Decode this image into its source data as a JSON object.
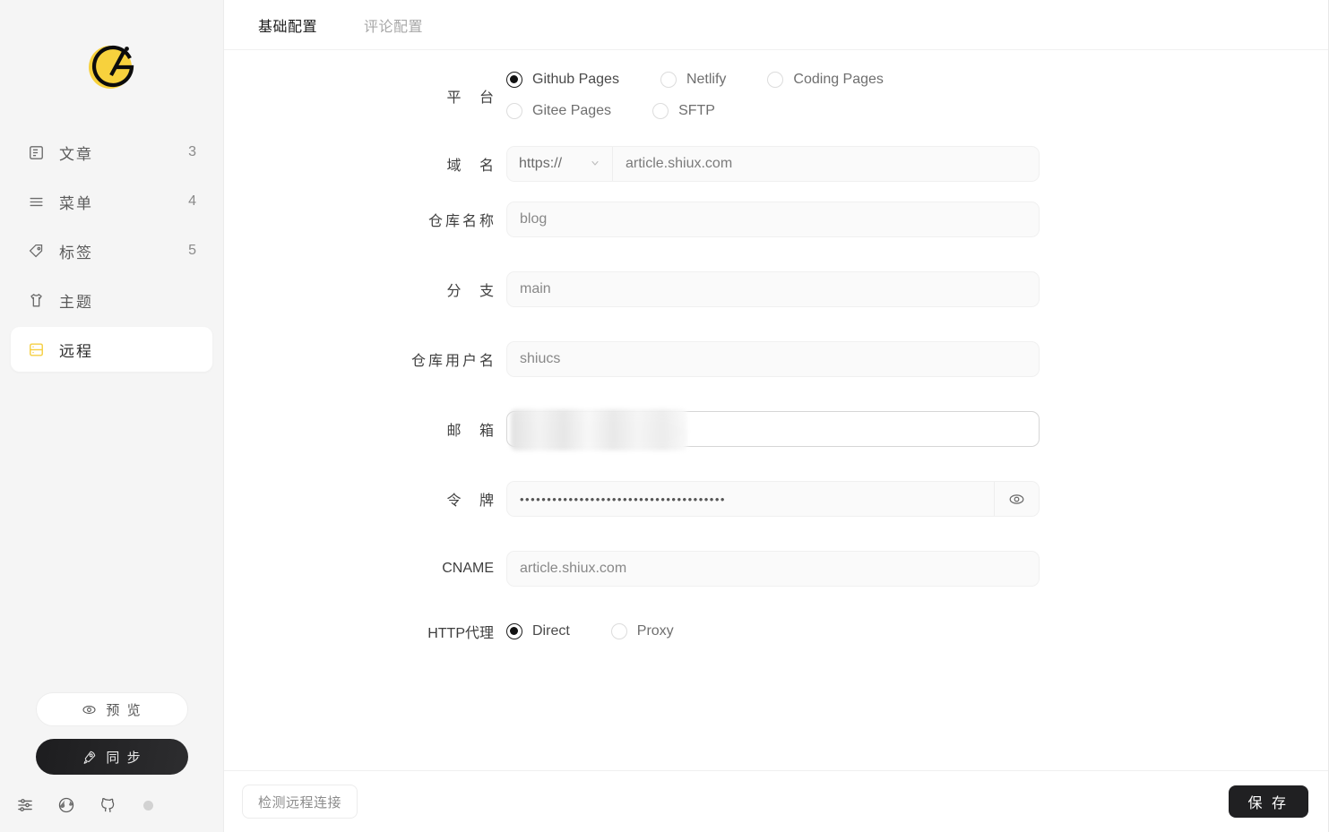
{
  "sidebar": {
    "logo_name": "gridea-logo",
    "items": [
      {
        "label": "文章",
        "count": "3",
        "icon": "article-icon",
        "active": false
      },
      {
        "label": "菜单",
        "count": "4",
        "icon": "menu-icon",
        "active": false
      },
      {
        "label": "标签",
        "count": "5",
        "icon": "tag-icon",
        "active": false
      },
      {
        "label": "主题",
        "count": "",
        "icon": "theme-icon",
        "active": false
      },
      {
        "label": "远程",
        "count": "",
        "icon": "server-icon",
        "active": true
      }
    ],
    "preview_button": "预 览",
    "sync_button": "同 步",
    "bottom_icons": [
      "settings-sliders-icon",
      "globe-icon",
      "github-icon",
      "status-dot-icon"
    ]
  },
  "tabs": [
    {
      "label": "基础配置",
      "active": true
    },
    {
      "label": "评论配置",
      "active": false
    }
  ],
  "form": {
    "platform": {
      "label": "平 台",
      "options": [
        {
          "label": "Github Pages",
          "selected": true
        },
        {
          "label": "Netlify",
          "selected": false
        },
        {
          "label": "Coding Pages",
          "selected": false
        },
        {
          "label": "Gitee Pages",
          "selected": false
        },
        {
          "label": "SFTP",
          "selected": false
        }
      ]
    },
    "domain": {
      "label": "域 名",
      "protocol": "https://",
      "value": "article.shiux.com"
    },
    "repository": {
      "label": "仓库名称",
      "value": "blog"
    },
    "branch": {
      "label": "分 支",
      "value": "main"
    },
    "username": {
      "label": "仓库用户名",
      "value": "shiucs"
    },
    "email": {
      "label": "邮 箱",
      "value": ""
    },
    "token": {
      "label": "令 牌",
      "value": "••••••••••••••••••••••••••••••••••••••",
      "toggle_icon": "eye-icon"
    },
    "cname": {
      "label": "CNAME",
      "value": "article.shiux.com"
    },
    "proxy": {
      "label": "HTTP代理",
      "options": [
        {
          "label": "Direct",
          "selected": true
        },
        {
          "label": "Proxy",
          "selected": false
        }
      ]
    }
  },
  "footer": {
    "test_button": "检测远程连接",
    "save_button": "保 存"
  },
  "colors": {
    "accent": "#f5cf43",
    "dark": "#202022",
    "sidebar_bg": "#f5f5f5"
  }
}
